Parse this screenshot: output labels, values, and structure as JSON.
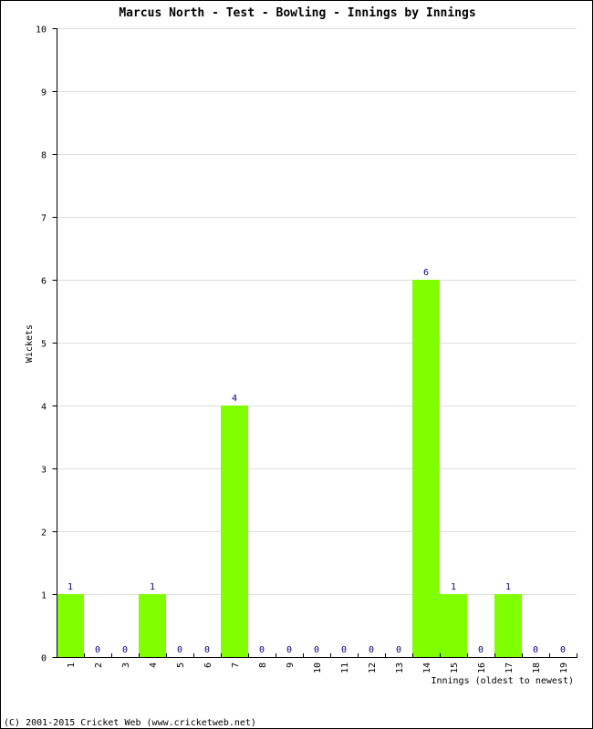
{
  "chart_data": {
    "type": "bar",
    "title": "Marcus North - Test - Bowling - Innings by Innings",
    "xlabel": "Innings (oldest to newest)",
    "ylabel": "Wickets",
    "ylim": [
      0,
      10
    ],
    "yticks": [
      0,
      1,
      2,
      3,
      4,
      5,
      6,
      7,
      8,
      9,
      10
    ],
    "grid": true,
    "categories": [
      "1",
      "2",
      "3",
      "4",
      "5",
      "6",
      "7",
      "8",
      "9",
      "10",
      "11",
      "12",
      "13",
      "14",
      "15",
      "16",
      "17",
      "18",
      "19"
    ],
    "values": [
      1,
      0,
      0,
      1,
      0,
      0,
      4,
      0,
      0,
      0,
      0,
      0,
      0,
      6,
      1,
      0,
      1,
      0,
      0
    ],
    "bar_color": "#7fff00",
    "label_color": "#000080",
    "grid_color": "#dddddd"
  },
  "footer": "(C) 2001-2015 Cricket Web (www.cricketweb.net)"
}
